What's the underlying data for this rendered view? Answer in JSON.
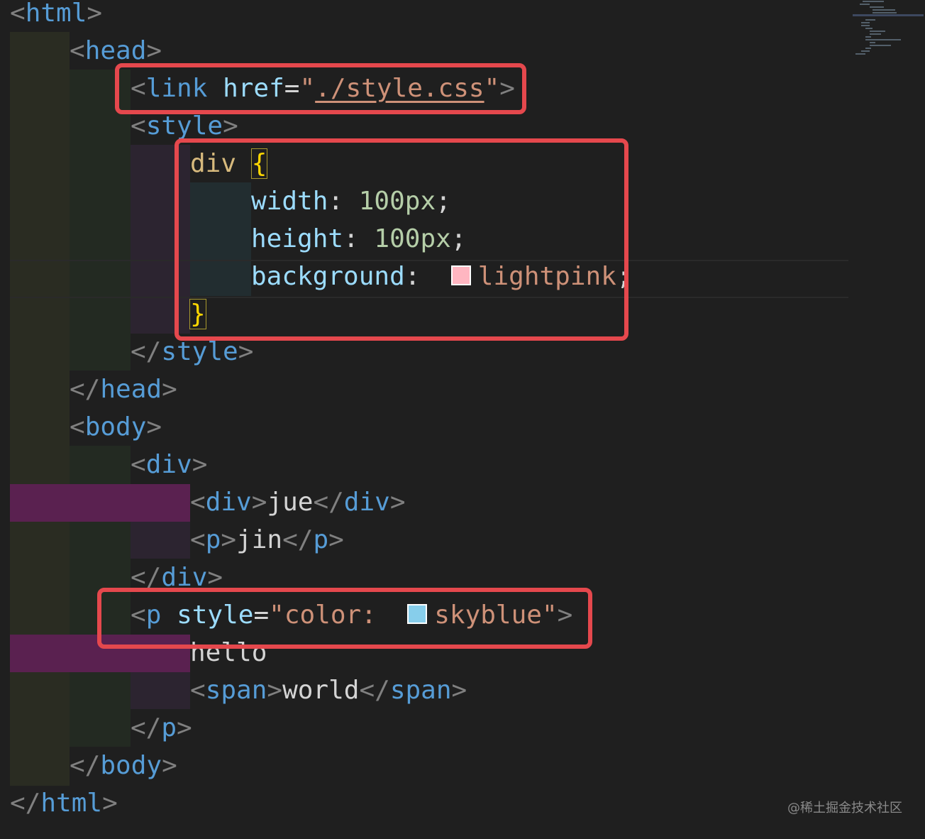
{
  "editor": {
    "lines": [
      {
        "open": "<",
        "tag": "html",
        "close": ">"
      },
      {
        "open": "<",
        "tag": "head",
        "close": ">"
      },
      {
        "open": "<",
        "tag": "link",
        "attr": "href",
        "eq": "=",
        "q1": "\"",
        "val": "./style.css",
        "q2": "\"",
        "close": ">"
      },
      {
        "open": "<",
        "tag": "style",
        "close": ">"
      },
      {
        "selector": "div",
        "brace": "{"
      },
      {
        "prop": "width",
        "colon": ":",
        "value": "100px",
        "semi": ";"
      },
      {
        "prop": "height",
        "colon": ":",
        "value": "100px",
        "semi": ";"
      },
      {
        "prop": "background",
        "colon": ":",
        "value": "lightpink",
        "semi": ";",
        "swatch": "#ffb6c1"
      },
      {
        "brace": "}"
      },
      {
        "open": "</",
        "tag": "style",
        "close": ">"
      },
      {
        "open": "</",
        "tag": "head",
        "close": ">"
      },
      {
        "open": "<",
        "tag": "body",
        "close": ">"
      },
      {
        "open": "<",
        "tag": "div",
        "close": ">"
      },
      {
        "open": "<",
        "tag": "div",
        "close": ">",
        "text": "jue",
        "open2": "</",
        "tag2": "div",
        "close2": ">"
      },
      {
        "open": "<",
        "tag": "p",
        "close": ">",
        "text": "jin",
        "open2": "</",
        "tag2": "p",
        "close2": ">"
      },
      {
        "open": "</",
        "tag": "div",
        "close": ">"
      },
      {
        "open": "<",
        "tag": "p",
        "attr": "style",
        "eq": "=",
        "q1": "\"",
        "val1": "color:",
        "val2": "skyblue",
        "q2": "\"",
        "close": ">",
        "swatch": "#87ceeb"
      },
      {
        "text": "hello"
      },
      {
        "open": "<",
        "tag": "span",
        "close": ">",
        "text": "world",
        "open2": "</",
        "tag2": "span",
        "close2": ">"
      },
      {
        "open": "</",
        "tag": "p",
        "close": ">"
      },
      {
        "open": "</",
        "tag": "body",
        "close": ">"
      },
      {
        "open": "</",
        "tag": "html",
        "close": ">"
      }
    ]
  },
  "colors": {
    "background": "#1f1f1f",
    "tag": "#569cd6",
    "punctuation": "#808080",
    "attribute": "#9cdcfe",
    "string": "#ce9178",
    "number": "#b5cea8",
    "selector": "#d7ba7d",
    "bracket": "#ffd700",
    "highlight_box": "#e5484d"
  },
  "watermark": "@稀土掘金技术社区"
}
